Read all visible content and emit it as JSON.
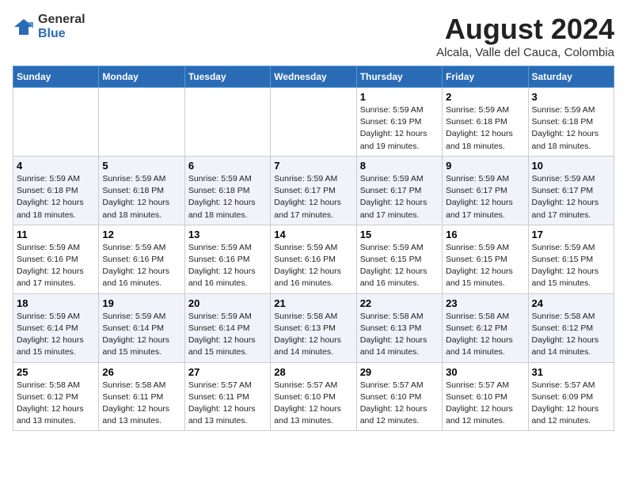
{
  "header": {
    "logo_general": "General",
    "logo_blue": "Blue",
    "month_year": "August 2024",
    "location": "Alcala, Valle del Cauca, Colombia"
  },
  "weekdays": [
    "Sunday",
    "Monday",
    "Tuesday",
    "Wednesday",
    "Thursday",
    "Friday",
    "Saturday"
  ],
  "weeks": [
    [
      {
        "day": "",
        "info": ""
      },
      {
        "day": "",
        "info": ""
      },
      {
        "day": "",
        "info": ""
      },
      {
        "day": "",
        "info": ""
      },
      {
        "day": "1",
        "info": "Sunrise: 5:59 AM\nSunset: 6:19 PM\nDaylight: 12 hours\nand 19 minutes."
      },
      {
        "day": "2",
        "info": "Sunrise: 5:59 AM\nSunset: 6:18 PM\nDaylight: 12 hours\nand 18 minutes."
      },
      {
        "day": "3",
        "info": "Sunrise: 5:59 AM\nSunset: 6:18 PM\nDaylight: 12 hours\nand 18 minutes."
      }
    ],
    [
      {
        "day": "4",
        "info": "Sunrise: 5:59 AM\nSunset: 6:18 PM\nDaylight: 12 hours\nand 18 minutes."
      },
      {
        "day": "5",
        "info": "Sunrise: 5:59 AM\nSunset: 6:18 PM\nDaylight: 12 hours\nand 18 minutes."
      },
      {
        "day": "6",
        "info": "Sunrise: 5:59 AM\nSunset: 6:18 PM\nDaylight: 12 hours\nand 18 minutes."
      },
      {
        "day": "7",
        "info": "Sunrise: 5:59 AM\nSunset: 6:17 PM\nDaylight: 12 hours\nand 17 minutes."
      },
      {
        "day": "8",
        "info": "Sunrise: 5:59 AM\nSunset: 6:17 PM\nDaylight: 12 hours\nand 17 minutes."
      },
      {
        "day": "9",
        "info": "Sunrise: 5:59 AM\nSunset: 6:17 PM\nDaylight: 12 hours\nand 17 minutes."
      },
      {
        "day": "10",
        "info": "Sunrise: 5:59 AM\nSunset: 6:17 PM\nDaylight: 12 hours\nand 17 minutes."
      }
    ],
    [
      {
        "day": "11",
        "info": "Sunrise: 5:59 AM\nSunset: 6:16 PM\nDaylight: 12 hours\nand 17 minutes."
      },
      {
        "day": "12",
        "info": "Sunrise: 5:59 AM\nSunset: 6:16 PM\nDaylight: 12 hours\nand 16 minutes."
      },
      {
        "day": "13",
        "info": "Sunrise: 5:59 AM\nSunset: 6:16 PM\nDaylight: 12 hours\nand 16 minutes."
      },
      {
        "day": "14",
        "info": "Sunrise: 5:59 AM\nSunset: 6:16 PM\nDaylight: 12 hours\nand 16 minutes."
      },
      {
        "day": "15",
        "info": "Sunrise: 5:59 AM\nSunset: 6:15 PM\nDaylight: 12 hours\nand 16 minutes."
      },
      {
        "day": "16",
        "info": "Sunrise: 5:59 AM\nSunset: 6:15 PM\nDaylight: 12 hours\nand 15 minutes."
      },
      {
        "day": "17",
        "info": "Sunrise: 5:59 AM\nSunset: 6:15 PM\nDaylight: 12 hours\nand 15 minutes."
      }
    ],
    [
      {
        "day": "18",
        "info": "Sunrise: 5:59 AM\nSunset: 6:14 PM\nDaylight: 12 hours\nand 15 minutes."
      },
      {
        "day": "19",
        "info": "Sunrise: 5:59 AM\nSunset: 6:14 PM\nDaylight: 12 hours\nand 15 minutes."
      },
      {
        "day": "20",
        "info": "Sunrise: 5:59 AM\nSunset: 6:14 PM\nDaylight: 12 hours\nand 15 minutes."
      },
      {
        "day": "21",
        "info": "Sunrise: 5:58 AM\nSunset: 6:13 PM\nDaylight: 12 hours\nand 14 minutes."
      },
      {
        "day": "22",
        "info": "Sunrise: 5:58 AM\nSunset: 6:13 PM\nDaylight: 12 hours\nand 14 minutes."
      },
      {
        "day": "23",
        "info": "Sunrise: 5:58 AM\nSunset: 6:12 PM\nDaylight: 12 hours\nand 14 minutes."
      },
      {
        "day": "24",
        "info": "Sunrise: 5:58 AM\nSunset: 6:12 PM\nDaylight: 12 hours\nand 14 minutes."
      }
    ],
    [
      {
        "day": "25",
        "info": "Sunrise: 5:58 AM\nSunset: 6:12 PM\nDaylight: 12 hours\nand 13 minutes."
      },
      {
        "day": "26",
        "info": "Sunrise: 5:58 AM\nSunset: 6:11 PM\nDaylight: 12 hours\nand 13 minutes."
      },
      {
        "day": "27",
        "info": "Sunrise: 5:57 AM\nSunset: 6:11 PM\nDaylight: 12 hours\nand 13 minutes."
      },
      {
        "day": "28",
        "info": "Sunrise: 5:57 AM\nSunset: 6:10 PM\nDaylight: 12 hours\nand 13 minutes."
      },
      {
        "day": "29",
        "info": "Sunrise: 5:57 AM\nSunset: 6:10 PM\nDaylight: 12 hours\nand 12 minutes."
      },
      {
        "day": "30",
        "info": "Sunrise: 5:57 AM\nSunset: 6:10 PM\nDaylight: 12 hours\nand 12 minutes."
      },
      {
        "day": "31",
        "info": "Sunrise: 5:57 AM\nSunset: 6:09 PM\nDaylight: 12 hours\nand 12 minutes."
      }
    ]
  ]
}
